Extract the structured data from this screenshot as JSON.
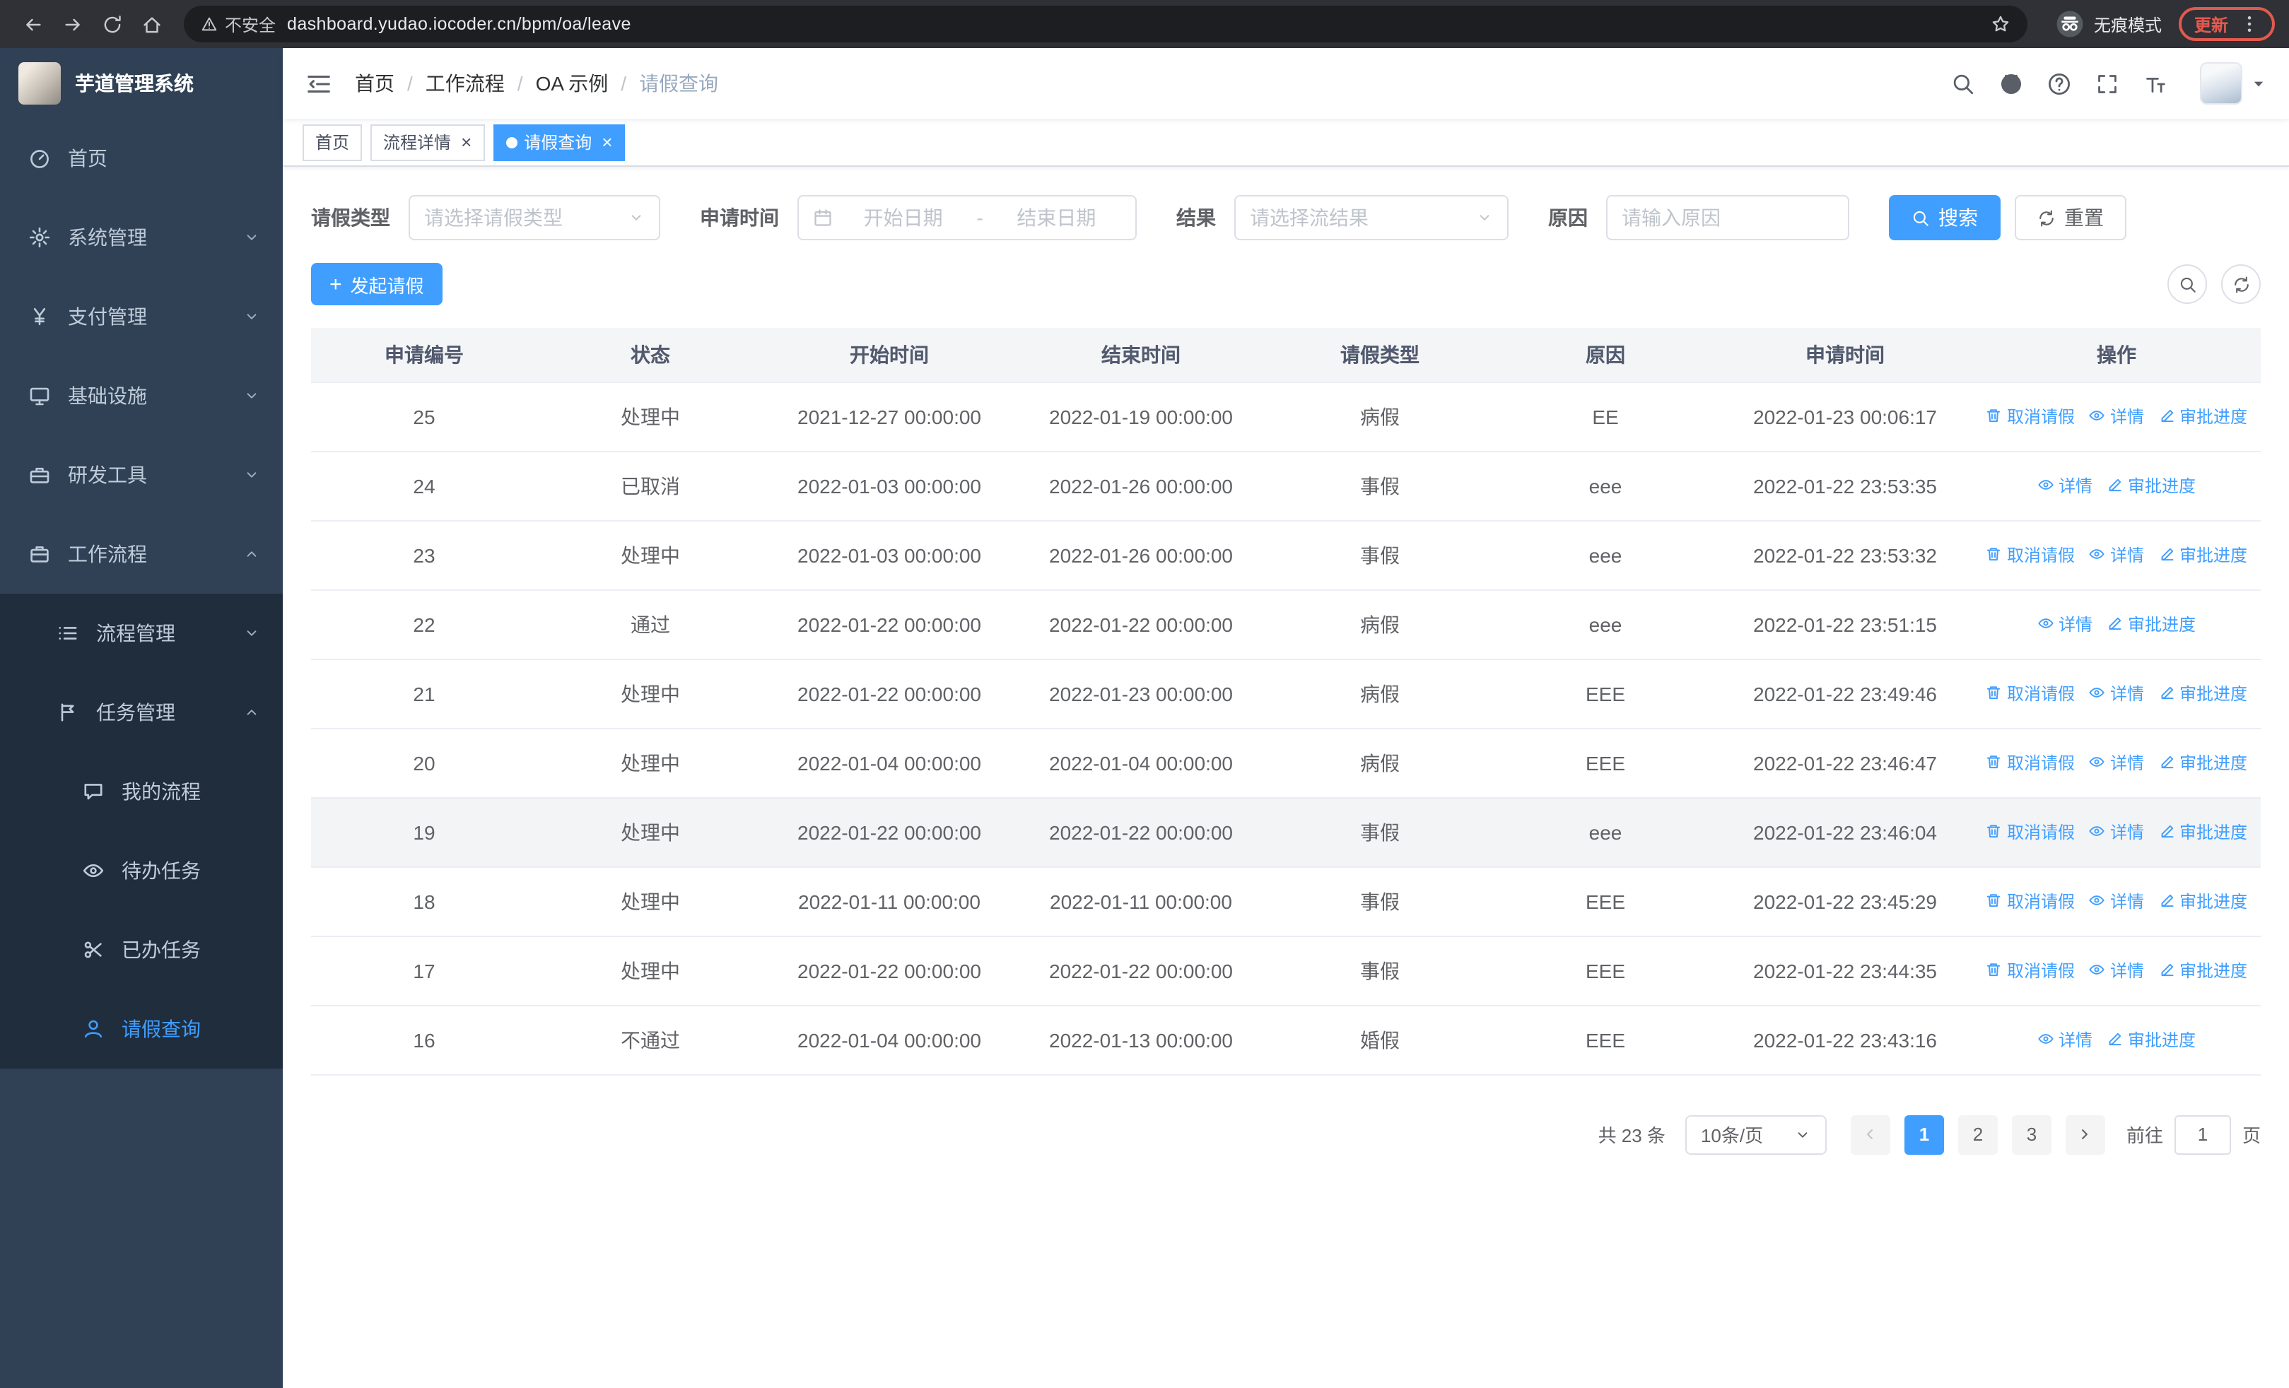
{
  "browser": {
    "security_label": "不安全",
    "url": "dashboard.yudao.iocoder.cn/bpm/oa/leave",
    "incognito_label": "无痕模式",
    "update_label": "更新"
  },
  "sidebar": {
    "logo_title": "芋道管理系统",
    "items": [
      {
        "name": "home",
        "label": "首页",
        "icon": "gauge-icon",
        "level": 1
      },
      {
        "name": "system-management",
        "label": "系统管理",
        "icon": "gear-icon",
        "level": 1,
        "chevron": "down"
      },
      {
        "name": "payment-management",
        "label": "支付管理",
        "icon": "yen-icon",
        "level": 1,
        "chevron": "down"
      },
      {
        "name": "infrastructure",
        "label": "基础设施",
        "icon": "monitor-icon",
        "level": 1,
        "chevron": "down"
      },
      {
        "name": "dev-tools",
        "label": "研发工具",
        "icon": "toolbox-icon",
        "level": 1,
        "chevron": "down"
      },
      {
        "name": "workflow",
        "label": "工作流程",
        "icon": "briefcase-icon",
        "level": 1,
        "chevron": "up"
      },
      {
        "name": "process-management",
        "label": "流程管理",
        "icon": "list-icon",
        "level": 2,
        "chevron": "down"
      },
      {
        "name": "task-management",
        "label": "任务管理",
        "icon": "flag-icon",
        "level": 2,
        "chevron": "up"
      },
      {
        "name": "my-process",
        "label": "我的流程",
        "icon": "chat-icon",
        "level": 3
      },
      {
        "name": "todo-tasks",
        "label": "待办任务",
        "icon": "eye-icon",
        "level": 3
      },
      {
        "name": "done-tasks",
        "label": "已办任务",
        "icon": "scissors-icon",
        "level": 3
      },
      {
        "name": "leave-query",
        "label": "请假查询",
        "icon": "user-icon",
        "level": 3,
        "active": true
      }
    ]
  },
  "header": {
    "breadcrumb": [
      "首页",
      "工作流程",
      "OA 示例",
      "请假查询"
    ]
  },
  "tabs": [
    {
      "name": "home",
      "label": "首页",
      "closable": false,
      "active": false
    },
    {
      "name": "process-detail",
      "label": "流程详情",
      "closable": true,
      "active": false
    },
    {
      "name": "leave-query",
      "label": "请假查询",
      "closable": true,
      "active": true
    }
  ],
  "filters": {
    "leave_type": {
      "label": "请假类型",
      "placeholder": "请选择请假类型"
    },
    "apply_time": {
      "label": "申请时间",
      "start_placeholder": "开始日期",
      "separator": "-",
      "end_placeholder": "结束日期"
    },
    "result": {
      "label": "结果",
      "placeholder": "请选择流结果"
    },
    "reason": {
      "label": "原因",
      "placeholder": "请输入原因"
    },
    "search_label": "搜索",
    "reset_label": "重置"
  },
  "toolbar": {
    "create_label": "发起请假"
  },
  "table": {
    "columns": [
      "申请编号",
      "状态",
      "开始时间",
      "结束时间",
      "请假类型",
      "原因",
      "申请时间",
      "操作"
    ],
    "rows": [
      {
        "id": "25",
        "status": "处理中",
        "start": "2021-12-27 00:00:00",
        "end": "2022-01-19 00:00:00",
        "type": "病假",
        "reason": "EE",
        "apply_time": "2022-01-23 00:06:17",
        "actions": [
          "cancel",
          "detail",
          "progress"
        ]
      },
      {
        "id": "24",
        "status": "已取消",
        "start": "2022-01-03 00:00:00",
        "end": "2022-01-26 00:00:00",
        "type": "事假",
        "reason": "eee",
        "apply_time": "2022-01-22 23:53:35",
        "actions": [
          "detail",
          "progress"
        ]
      },
      {
        "id": "23",
        "status": "处理中",
        "start": "2022-01-03 00:00:00",
        "end": "2022-01-26 00:00:00",
        "type": "事假",
        "reason": "eee",
        "apply_time": "2022-01-22 23:53:32",
        "actions": [
          "cancel",
          "detail",
          "progress"
        ]
      },
      {
        "id": "22",
        "status": "通过",
        "start": "2022-01-22 00:00:00",
        "end": "2022-01-22 00:00:00",
        "type": "病假",
        "reason": "eee",
        "apply_time": "2022-01-22 23:51:15",
        "actions": [
          "detail",
          "progress"
        ]
      },
      {
        "id": "21",
        "status": "处理中",
        "start": "2022-01-22 00:00:00",
        "end": "2022-01-23 00:00:00",
        "type": "病假",
        "reason": "EEE",
        "apply_time": "2022-01-22 23:49:46",
        "actions": [
          "cancel",
          "detail",
          "progress"
        ]
      },
      {
        "id": "20",
        "status": "处理中",
        "start": "2022-01-04 00:00:00",
        "end": "2022-01-04 00:00:00",
        "type": "病假",
        "reason": "EEE",
        "apply_time": "2022-01-22 23:46:47",
        "actions": [
          "cancel",
          "detail",
          "progress"
        ]
      },
      {
        "id": "19",
        "status": "处理中",
        "start": "2022-01-22 00:00:00",
        "end": "2022-01-22 00:00:00",
        "type": "事假",
        "reason": "eee",
        "apply_time": "2022-01-22 23:46:04",
        "actions": [
          "cancel",
          "detail",
          "progress"
        ],
        "highlighted": true
      },
      {
        "id": "18",
        "status": "处理中",
        "start": "2022-01-11 00:00:00",
        "end": "2022-01-11 00:00:00",
        "type": "事假",
        "reason": "EEE",
        "apply_time": "2022-01-22 23:45:29",
        "actions": [
          "cancel",
          "detail",
          "progress"
        ]
      },
      {
        "id": "17",
        "status": "处理中",
        "start": "2022-01-22 00:00:00",
        "end": "2022-01-22 00:00:00",
        "type": "事假",
        "reason": "EEE",
        "apply_time": "2022-01-22 23:44:35",
        "actions": [
          "cancel",
          "detail",
          "progress"
        ]
      },
      {
        "id": "16",
        "status": "不通过",
        "start": "2022-01-04 00:00:00",
        "end": "2022-01-13 00:00:00",
        "type": "婚假",
        "reason": "EEE",
        "apply_time": "2022-01-22 23:43:16",
        "actions": [
          "detail",
          "progress"
        ]
      }
    ]
  },
  "actions": {
    "cancel": {
      "label": "取消请假",
      "icon": "trash-icon"
    },
    "detail": {
      "label": "详情",
      "icon": "eye-icon"
    },
    "progress": {
      "label": "审批进度",
      "icon": "edit-icon"
    }
  },
  "pagination": {
    "total_text": "共 23 条",
    "page_size": "10条/页",
    "pages": [
      "1",
      "2",
      "3"
    ],
    "active_page": "1",
    "goto_label": "前往",
    "goto_value": "1",
    "page_suffix": "页"
  }
}
